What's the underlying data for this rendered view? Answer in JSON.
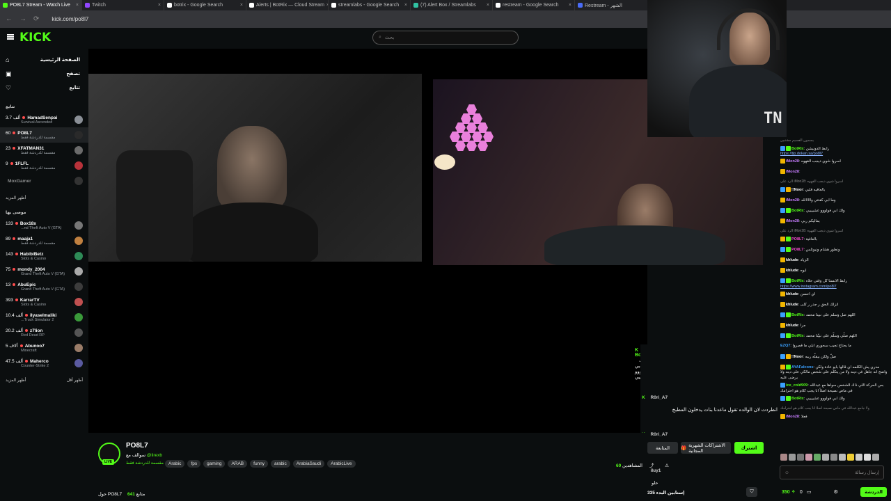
{
  "browser": {
    "tabs": [
      {
        "label": "PO8L7 Stream - Watch Live",
        "color": "#53fc18",
        "active": true
      },
      {
        "label": "Twitch",
        "color": "#9146ff",
        "active": false
      },
      {
        "label": "botrix - Google Search",
        "color": "#ffffff",
        "active": false
      },
      {
        "label": "Alerts | BotRix — Cloud Stream",
        "color": "#ffffff",
        "active": false
      },
      {
        "label": "streamlabs - Google Search",
        "color": "#ffffff",
        "active": false
      },
      {
        "label": "(7) Alert Box / Streamlabs",
        "color": "#31c3a2",
        "active": false
      },
      {
        "label": "restream - Google Search",
        "color": "#ffffff",
        "active": false
      },
      {
        "label": "Restream - الشهر",
        "color": "#4a6cf7",
        "active": false
      }
    ],
    "url": "kick.com/po8l7"
  },
  "header": {
    "logo": "KICK",
    "search_placeholder": "بحث"
  },
  "sidebar": {
    "nav": [
      {
        "label": "الصفحة الرئيسية",
        "icon": "home-icon"
      },
      {
        "label": "تصفح",
        "icon": "browse-icon"
      },
      {
        "label": "تتابع",
        "icon": "heart-icon"
      }
    ],
    "following_label": "تتابع",
    "following": [
      {
        "count": "3.7 ألف",
        "name": "HamadSenpai",
        "cat": "Survival Ascended",
        "sel": false
      },
      {
        "count": "60",
        "name": "PO8L7",
        "cat": "مقسمة للدردشة فقط",
        "sel": true
      },
      {
        "count": "23",
        "name": "XFATMAN31",
        "cat": "مقسمة للدردشة فقط",
        "sel": false
      },
      {
        "count": "9",
        "name": "1FLFL",
        "cat": "مقسمة للدردشة فقط",
        "sel": false
      },
      {
        "count": "",
        "name": "MoxGamer",
        "cat": "",
        "sel": false
      }
    ],
    "more1": "أظهر المزيد",
    "recommended_label": "موصى بها",
    "recommended": [
      {
        "count": "133",
        "name": "Box18x",
        "cat": "...nd Theft Auto V (GTA)"
      },
      {
        "count": "89",
        "name": "maaja1",
        "cat": "مقسمة للدردشة فقط"
      },
      {
        "count": "143",
        "name": "HabibiBetz",
        "cat": "Slots & Casino"
      },
      {
        "count": "75",
        "name": "mondy_2004",
        "cat": "Grand Theft Auto V (GTA)"
      },
      {
        "count": "13",
        "name": "AbuEpic",
        "cat": "Grand Theft Auto V (GTA)"
      },
      {
        "count": "393",
        "name": "KarrarTV",
        "cat": "Slots & Casino"
      },
      {
        "count": "10.4 ألف",
        "name": "ilyaselmaliki",
        "cat": "...Truck Simulator 2"
      },
      {
        "count": "20.2 ألف",
        "name": "z7lion",
        "cat": "Red Dead RP"
      },
      {
        "count": "5 آلاف",
        "name": "Abunoo7",
        "cat": "Minecraft"
      },
      {
        "count": "47.5 ألف",
        "name": "Maherco",
        "cat": "Counter-Strike 2"
      }
    ],
    "more2": "أظهر المزيد",
    "show_less": "أظهر أقل"
  },
  "player": {
    "overlay_msgs": [
      {
        "user": "BotRix",
        "text": "ولك ابي فولوووو عشييييي"
      },
      {
        "user": "R0ri_A7",
        "text": ""
      },
      {
        "user": "",
        "text": "انطردت لان الوالده تقول ماعدنا بنات يدخلون المطبخ"
      },
      {
        "user": "R0ri_A7",
        "text": ""
      }
    ],
    "follow_label": "المتابعة",
    "gift_label": "الاشتراكات الشهرية المجانية",
    "subscribe_label": "اشترك"
  },
  "stream": {
    "name": "PO8L7",
    "live": "LIVE",
    "title_prefix": "سوالف مع",
    "title_user": "@lirexb",
    "category": "مقسمة للدردشة فقط",
    "tags": [
      "Arabic",
      "fps",
      "gaming",
      "ARAB",
      "funny",
      "arabic",
      "ArabiaSaudi",
      "ArabicLive"
    ],
    "viewers_label": "المشاهدين",
    "viewers": "60",
    "about_label": "حول PO8L7",
    "followers_count": "641",
    "followers_label": "متابع"
  },
  "midchat": {
    "users": [
      "iluy1"
    ],
    "msg1": "حلو",
    "count_label": "إستابين البدء 335"
  },
  "webcam": {
    "shirt_text": "TN"
  },
  "chat": {
    "messages": [
      {
        "user": "",
        "text": "يسمون الفسيم مشتبين",
        "link": "",
        "badges": [],
        "sys": true,
        "ucolor": "#ffffff"
      },
      {
        "user": "BotRix",
        "text": "رابط الدونيشن",
        "link": "https://tip.dokan.sa/po8l7",
        "badges": [
          "b",
          "g"
        ],
        "ucolor": "#53fc18"
      },
      {
        "user": "iMon28",
        "text": "اسروا شوي ديجب القهوه",
        "link": "",
        "badges": [
          "y"
        ],
        "ucolor": "#c77dff"
      },
      {
        "user": "iMon28",
        "text": "",
        "link": "",
        "badges": [
          "y"
        ],
        "ucolor": "#c77dff"
      },
      {
        "user": "",
        "text": "الرد على iMon28: اسروا شوي ديجب القهوه",
        "link": "",
        "badges": [],
        "sys": true,
        "ucolor": "#ffffff"
      },
      {
        "user": "!!Noor",
        "text": "بالعافيه قلبي",
        "link": "",
        "badges": [
          "b",
          "y"
        ],
        "ucolor": "#ffffff"
      },
      {
        "user": "iMon28",
        "text": "وما ابي كفتتي وااااالله",
        "link": "",
        "badges": [
          "y"
        ],
        "ucolor": "#c77dff"
      },
      {
        "user": "BotRix",
        "text": "ولك ابي فولووو عشييييي",
        "link": "",
        "badges": [
          "b",
          "g"
        ],
        "ucolor": "#53fc18"
      },
      {
        "user": "iMon28",
        "text": "بماليكم ربي",
        "link": "",
        "badges": [
          "y"
        ],
        "ucolor": "#c77dff"
      },
      {
        "user": "",
        "text": "الرد على iMon28: اسروا شوي ديجب القهوه",
        "link": "",
        "badges": [],
        "sys": true,
        "ucolor": "#ffffff"
      },
      {
        "user": "PO8L7",
        "text": "بالعافية",
        "link": "",
        "badges": [
          "y",
          "g"
        ],
        "ucolor": "#ff4fd8"
      },
      {
        "user": "PO8L7",
        "text": "ونطور هشام ونيوتلس",
        "link": "",
        "badges": [
          "b",
          "g"
        ],
        "ucolor": "#ff4fd8"
      },
      {
        "user": "khlude",
        "text": "الزياد",
        "link": "",
        "badges": [
          "y"
        ],
        "ucolor": "#ffffff"
      },
      {
        "user": "khlude",
        "text": "ايوه",
        "link": "",
        "badges": [
          "y"
        ],
        "ucolor": "#ffffff"
      },
      {
        "user": "BotRix",
        "text": "رابط الانستا كل وقتي حلاه",
        "link": "https://www.instagram.com/po8l7",
        "badges": [
          "b",
          "g"
        ],
        "ucolor": "#53fc18"
      },
      {
        "user": "khlude",
        "text": "اي احسن",
        "link": "",
        "badges": [
          "y"
        ],
        "ucolor": "#ffffff"
      },
      {
        "user": "khlude",
        "text": "انزلك الحق ر جدر ر كلى",
        "link": "",
        "badges": [
          "y"
        ],
        "ucolor": "#ffffff"
      },
      {
        "user": "BotRix",
        "text": "اللهم صل وسلم على نبينا محمد",
        "link": "",
        "badges": [
          "b",
          "g"
        ],
        "ucolor": "#53fc18"
      },
      {
        "user": "khlude",
        "text": "مرا",
        "link": "",
        "badges": [
          "y"
        ],
        "ucolor": "#ffffff"
      },
      {
        "user": "BotRix",
        "text": "اللهم صلّي وسلّم على نبيّنا محمد",
        "link": "",
        "badges": [
          "b",
          "g"
        ],
        "ucolor": "#53fc18"
      },
      {
        "user": "EZQ7",
        "text": "ما يحتاج تجيب سحوري ابلي ما قصروا",
        "link": "",
        "badges": [],
        "ucolor": "#3aa0ff"
      },
      {
        "user": "!!Noor",
        "text": "صلّ ولكن بيقلّه ريبه",
        "link": "",
        "badges": [
          "b",
          "y"
        ],
        "ucolor": "#ffffff"
      },
      {
        "user": "AYAFalcons",
        "text": "مدري يش الكلمه اي قالها بابو عادة ولكن واضح انه جاهل في دينه ولا من يتكلم على شخص مالكي على دينه ولا يرضى عليه",
        "link": "",
        "badges": [
          "y",
          "g"
        ],
        "ucolor": "#3aa0ff"
      },
      {
        "user": "ice_cold909",
        "text": "بس الحركة اللي ذاك الشخص سواها مع عبدالله في ماص نصيحة اصلاً انا يجب كلام هو احترامك",
        "link": "",
        "badges": [
          "b"
        ],
        "ucolor": "#53fc18"
      },
      {
        "user": "BotRix",
        "text": "ولك ابي فولووو عشييييي",
        "link": "",
        "badges": [
          "b",
          "g"
        ],
        "ucolor": "#53fc18"
      },
      {
        "user": "",
        "text": "ولا جامع عبدالله في ماص نصيحة اصلا انا يجب كلام هو احترامك",
        "link": "",
        "badges": [],
        "sys": true,
        "ucolor": "#ffffff"
      },
      {
        "user": "iMon28",
        "text": "فعلا",
        "link": "",
        "badges": [
          "y"
        ],
        "ucolor": "#c77dff"
      }
    ],
    "input_placeholder": "إرسال رسالة",
    "points": "350",
    "zero": "0",
    "send_label": "الدردشة"
  }
}
